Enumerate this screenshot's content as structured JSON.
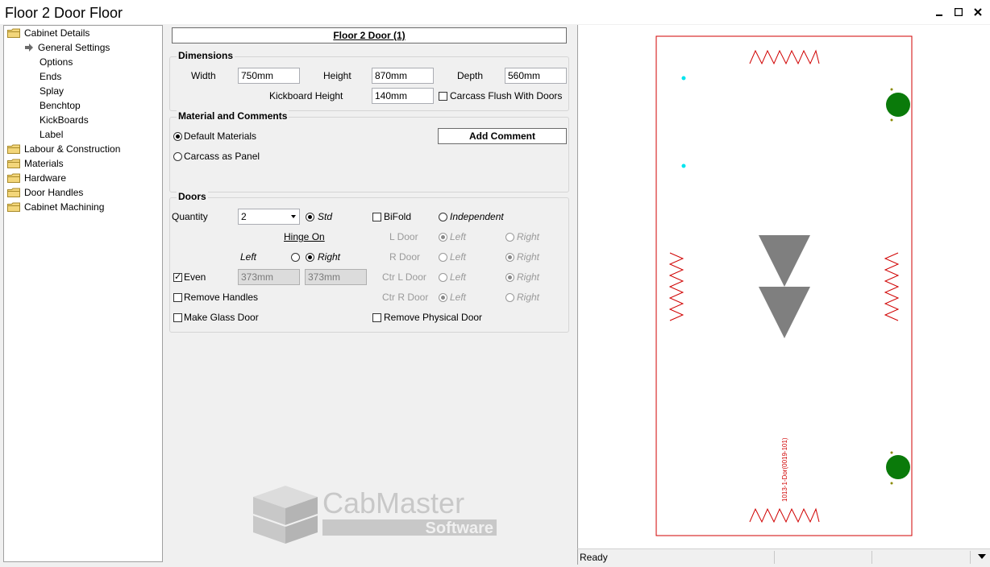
{
  "window": {
    "title": "Floor 2 Door Floor"
  },
  "tree": {
    "items": [
      {
        "label": "Cabinet Details",
        "type": "folder"
      },
      {
        "label": "General Settings",
        "type": "selected"
      },
      {
        "label": "Options",
        "type": "leaf"
      },
      {
        "label": "Ends",
        "type": "leaf"
      },
      {
        "label": "Splay",
        "type": "leaf"
      },
      {
        "label": "Benchtop",
        "type": "leaf"
      },
      {
        "label": "KickBoards",
        "type": "leaf"
      },
      {
        "label": "Label",
        "type": "leaf"
      },
      {
        "label": "Labour & Construction",
        "type": "folder"
      },
      {
        "label": "Materials",
        "type": "folder"
      },
      {
        "label": "Hardware",
        "type": "folder"
      },
      {
        "label": "Door Handles",
        "type": "folder"
      },
      {
        "label": "Cabinet Machining",
        "type": "folder"
      }
    ]
  },
  "header": {
    "title": "Floor 2 Door (1)"
  },
  "dimensions": {
    "group_title": "Dimensions",
    "width_label": "Width",
    "width_value": "750mm",
    "height_label": "Height",
    "height_value": "870mm",
    "depth_label": "Depth",
    "depth_value": "560mm",
    "kickboard_label": "Kickboard Height",
    "kickboard_value": "140mm",
    "carcass_flush_label": "Carcass Flush With Doors"
  },
  "material": {
    "group_title": "Material and Comments",
    "default_materials_label": "Default Materials",
    "carcass_panel_label": "Carcass as Panel",
    "add_comment_label": "Add Comment"
  },
  "doors": {
    "group_title": "Doors",
    "quantity_label": "Quantity",
    "quantity_value": "2",
    "std_label": "Std",
    "bifold_label": "BiFold",
    "independent_label": "Independent",
    "hinge_on_label": "Hinge On",
    "left_label": "Left",
    "right_label": "Right",
    "even_label": "Even",
    "width1_value": "373mm",
    "width2_value": "373mm",
    "remove_handles_label": "Remove Handles",
    "make_glass_label": "Make Glass Door",
    "remove_physical_label": "Remove Physical Door",
    "l_door_label": "L Door",
    "r_door_label": "R Door",
    "ctr_l_door_label": "Ctr L Door",
    "ctr_r_door_label": "Ctr R Door",
    "opt_left": "Left",
    "opt_right": "Right"
  },
  "logo": {
    "line1": "CabMaster",
    "line2": "Software"
  },
  "preview": {
    "label_text": "1013-1-Dor(0019-101)"
  },
  "status": {
    "text": "Ready"
  },
  "colors": {
    "accent_red": "#d00000",
    "hinge_green": "#0a7a0a",
    "cyan_dot": "#00e5ee",
    "arrow_grey": "#7f7f7f"
  }
}
